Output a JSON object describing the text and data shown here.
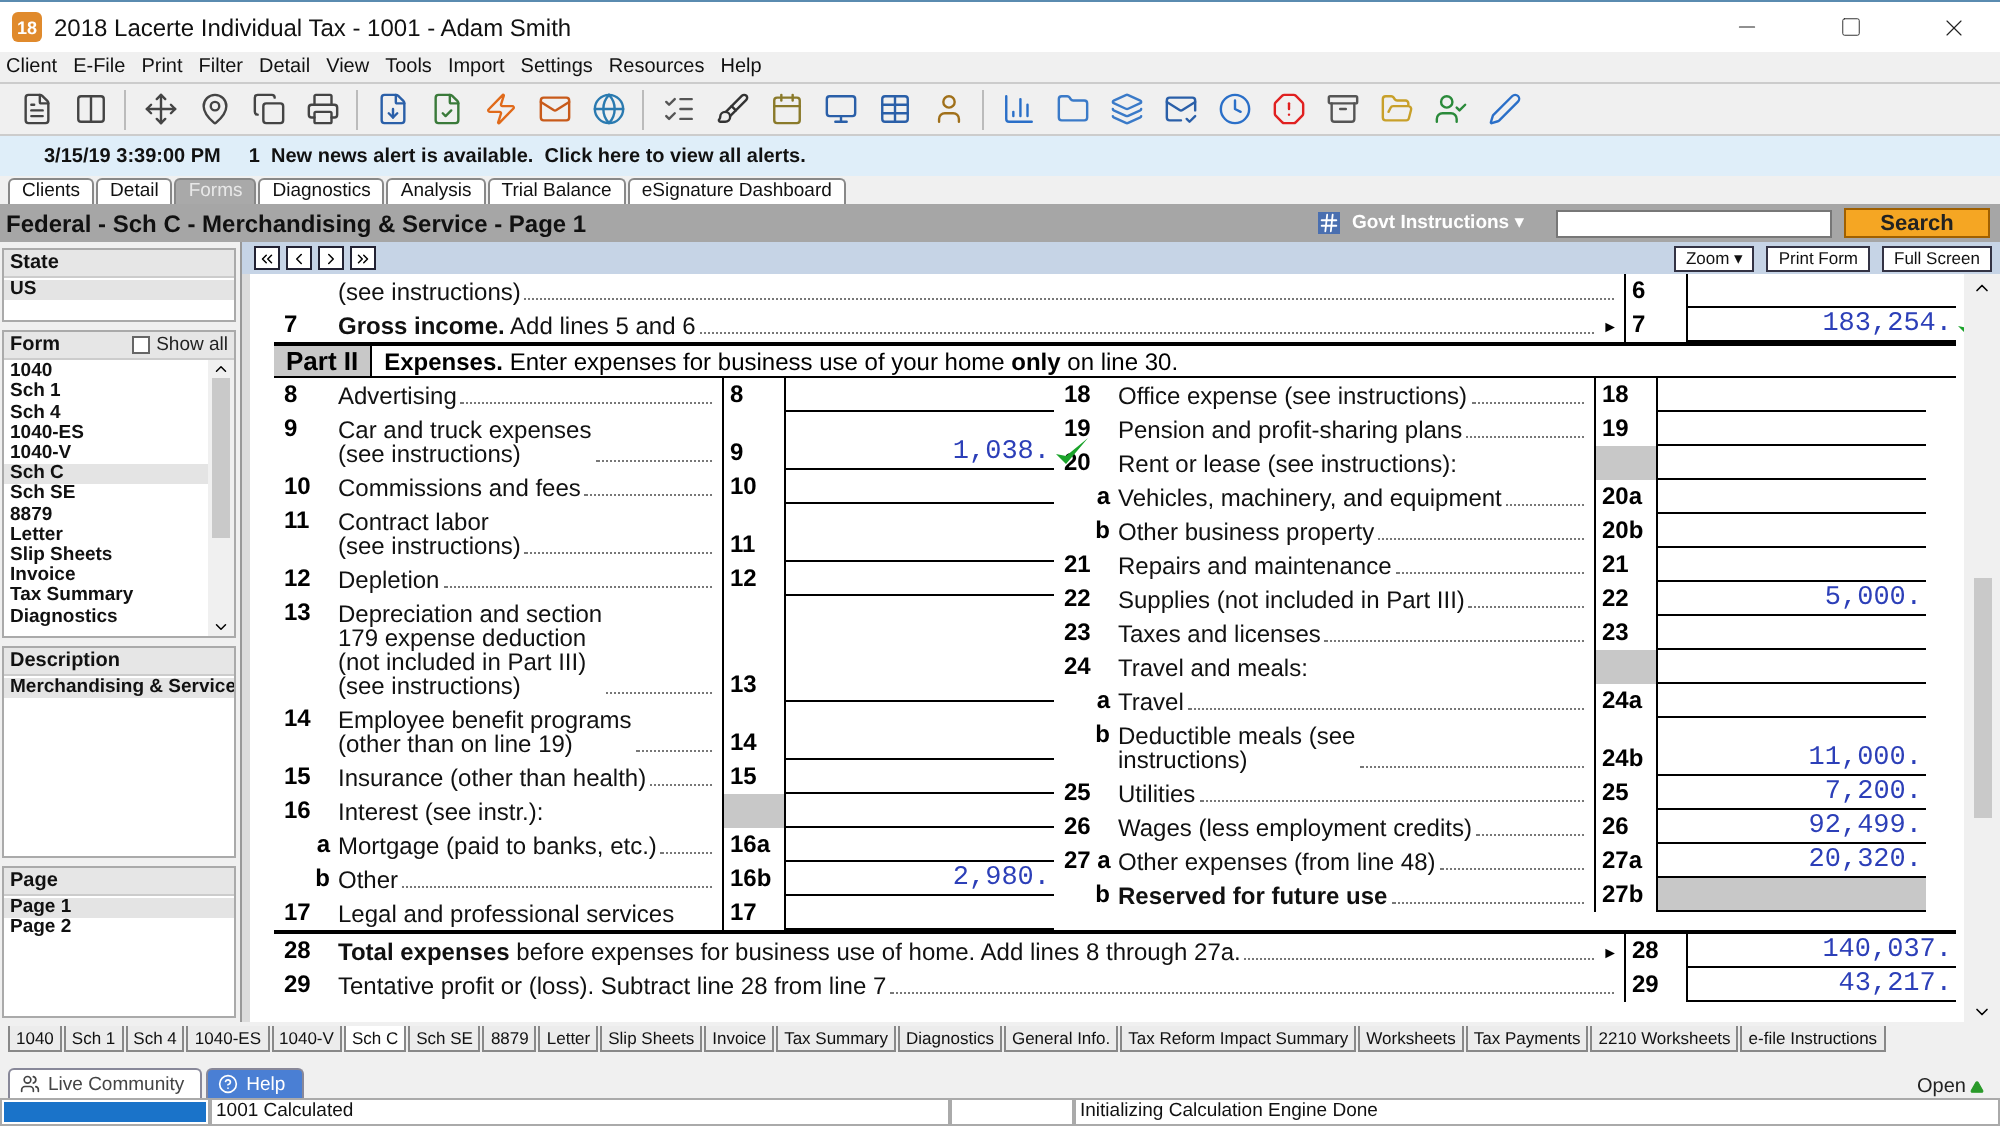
{
  "window": {
    "app_icon_text": "18",
    "title": "2018 Lacerte Individual Tax - 1001 - Adam Smith"
  },
  "menu": [
    "Client",
    "E-File",
    "Print",
    "Filter",
    "Detail",
    "View",
    "Tools",
    "Import",
    "Settings",
    "Resources",
    "Help"
  ],
  "alert": {
    "time": "3/15/19 3:39:00 PM",
    "message": "1  New news alert is available.  Click here to view all alerts."
  },
  "tabs": [
    {
      "label": "Clients",
      "selected": false
    },
    {
      "label": "Detail",
      "selected": false
    },
    {
      "label": "Forms",
      "selected": true
    },
    {
      "label": "Diagnostics",
      "selected": false
    },
    {
      "label": "Analysis",
      "selected": false
    },
    {
      "label": "Trial Balance",
      "selected": false
    },
    {
      "label": "eSignature Dashboard",
      "selected": false
    }
  ],
  "form_header": {
    "title": "Federal - Sch C - Merchandising & Service - Page 1",
    "instructions": "Govt Instructions ▾",
    "search_button": "Search"
  },
  "sidebar": {
    "state": {
      "heading": "State",
      "items": [
        {
          "label": "US",
          "selected": true
        }
      ]
    },
    "form": {
      "heading": "Form",
      "show_all": {
        "label": "Show all",
        "checked": false
      },
      "items": [
        {
          "label": "1040",
          "selected": false
        },
        {
          "label": "Sch 1",
          "selected": false
        },
        {
          "label": "Sch 4",
          "selected": false
        },
        {
          "label": "1040-ES",
          "selected": false
        },
        {
          "label": "1040-V",
          "selected": false
        },
        {
          "label": "Sch C",
          "selected": true
        },
        {
          "label": "Sch SE",
          "selected": false
        },
        {
          "label": "8879",
          "selected": false
        },
        {
          "label": "Letter",
          "selected": false
        },
        {
          "label": "Slip Sheets",
          "selected": false
        },
        {
          "label": "Invoice",
          "selected": false
        },
        {
          "label": "Tax Summary",
          "selected": false
        },
        {
          "label": "Diagnostics",
          "selected": false
        }
      ]
    },
    "description": {
      "heading": "Description",
      "items": [
        {
          "label": "Merchandising & Service",
          "selected": true
        }
      ]
    },
    "page": {
      "heading": "Page",
      "items": [
        {
          "label": "Page 1",
          "selected": true
        },
        {
          "label": "Page 2",
          "selected": false
        }
      ]
    }
  },
  "form_toolbar": {
    "buttons": [
      "Zoom ▾",
      "Print Form",
      "Full Screen"
    ]
  },
  "form": {
    "top_rows": [
      {
        "label": "(see instructions)",
        "leader": true,
        "code": "6",
        "verified": false
      },
      {
        "kind": "main",
        "num": "7",
        "label": "**Gross income.** Add lines 5 and 6",
        "leader": true,
        "arrow": "►",
        "code": "7",
        "value": "183,254.",
        "verified": true
      }
    ],
    "part": {
      "label": "Part II",
      "title": "**Expenses.** Enter expenses for business use of your home **only** on line 30."
    },
    "left_lines": [
      {
        "kind": "main",
        "num": "8",
        "label": "Advertising",
        "leader": true,
        "code": "8",
        "verified": false
      },
      {
        "kind": "main",
        "num": "9",
        "label": "Car and truck expenses\n(see instructions)",
        "leader": true,
        "code": "9",
        "value": "1,038.",
        "verified": true
      },
      {
        "kind": "main",
        "num": "10",
        "label": "Commissions and fees",
        "leader": true,
        "code": "10",
        "verified": false
      },
      {
        "kind": "main",
        "num": "11",
        "label": "Contract labor\n(see instructions)",
        "leader": true,
        "code": "11",
        "verified": false
      },
      {
        "kind": "main",
        "num": "12",
        "label": "Depletion",
        "leader": true,
        "code": "12",
        "verified": false
      },
      {
        "kind": "main",
        "num": "13",
        "label": "Depreciation and section\n179 expense deduction\n(not included in Part III)\n(see instructions)",
        "leader": true,
        "code": "13",
        "verified": false
      },
      {
        "kind": "main",
        "num": "14",
        "label": "Employee benefit programs\n(other than on line 19)",
        "leader": true,
        "code": "14",
        "verified": false
      },
      {
        "kind": "main",
        "num": "15",
        "label": "Insurance (other than health)",
        "leader": true,
        "code": "15",
        "verified": false
      },
      {
        "kind": "main",
        "num": "16",
        "label": "Interest (see instr.):",
        "leader": false,
        "code_shaded": true,
        "verified": false
      },
      {
        "kind": "sub",
        "num": "a",
        "label": "Mortgage (paid to banks, etc.)",
        "leader": true,
        "code": "16a",
        "verified": false
      },
      {
        "kind": "sub",
        "num": "b",
        "label": "Other",
        "leader": true,
        "code": "16b",
        "value": "2,980.",
        "verified": false
      },
      {
        "kind": "main",
        "num": "17",
        "label": "Legal and professional services",
        "leader": false,
        "code": "17",
        "verified": false
      }
    ],
    "right_lines": [
      {
        "kind": "main",
        "num": "18",
        "label": "Office expense (see instructions)",
        "leader": true,
        "code": "18",
        "verified": false
      },
      {
        "kind": "main",
        "num": "19",
        "label": "Pension and profit-sharing plans",
        "leader": true,
        "code": "19",
        "verified": false
      },
      {
        "kind": "main",
        "num": "20",
        "label": "Rent or lease (see instructions):",
        "leader": false,
        "code_shaded": true,
        "verified": false
      },
      {
        "kind": "sub",
        "num": "a",
        "label": "Vehicles, machinery, and equipment",
        "leader": true,
        "code": "20a",
        "verified": false
      },
      {
        "kind": "sub",
        "num": "b",
        "label": "Other business property",
        "leader": true,
        "code": "20b",
        "verified": false
      },
      {
        "kind": "main",
        "num": "21",
        "label": "Repairs and maintenance",
        "leader": true,
        "code": "21",
        "verified": false
      },
      {
        "kind": "main",
        "num": "22",
        "label": "Supplies (not included in Part III)",
        "leader": true,
        "code": "22",
        "value": "5,000.",
        "verified": false
      },
      {
        "kind": "main",
        "num": "23",
        "label": "Taxes and licenses",
        "leader": true,
        "code": "23",
        "verified": false
      },
      {
        "kind": "main",
        "num": "24",
        "label": "Travel and meals:",
        "leader": false,
        "code_shaded": true,
        "verified": false
      },
      {
        "kind": "sub",
        "num": "a",
        "label": "Travel",
        "leader": true,
        "code": "24a",
        "verified": false
      },
      {
        "kind": "sub",
        "num": "b",
        "label": "Deductible meals (see\ninstructions)",
        "leader": true,
        "code": "24b",
        "value": "11,000.",
        "verified": false
      },
      {
        "kind": "main",
        "num": "25",
        "label": "Utilities",
        "leader": true,
        "code": "25",
        "value": "7,200.",
        "verified": false
      },
      {
        "kind": "main",
        "num": "26",
        "label": "Wages (less employment credits)",
        "leader": true,
        "code": "26",
        "value": "92,499.",
        "verified": false
      },
      {
        "kind": "main",
        "num": "27 a",
        "label": "Other expenses (from line 48)",
        "leader": true,
        "code": "27a",
        "value": "20,320.",
        "verified": false
      },
      {
        "kind": "sub",
        "num": "b",
        "label": "Reserved for future use",
        "strong": true,
        "leader": true,
        "code": "27b",
        "value_shaded": true,
        "verified": false
      }
    ],
    "bottom_rows": [
      {
        "kind": "main",
        "num": "28",
        "label": "**Total expenses** before expenses for business use of home. Add lines 8 through 27a.",
        "leader": true,
        "arrow": "►",
        "code": "28",
        "value": "140,037.",
        "verified": false
      },
      {
        "kind": "main",
        "num": "29",
        "label": "Tentative profit or (loss). Subtract line 28 from line 7",
        "leader": true,
        "code": "29",
        "value": "43,217.",
        "verified": false
      }
    ]
  },
  "form_tabs": [
    {
      "label": "1040",
      "selected": false
    },
    {
      "label": "Sch 1",
      "selected": false
    },
    {
      "label": "Sch 4",
      "selected": false
    },
    {
      "label": "1040-ES",
      "selected": false
    },
    {
      "label": "1040-V",
      "selected": false
    },
    {
      "label": "Sch C",
      "selected": true
    },
    {
      "label": "Sch SE",
      "selected": false
    },
    {
      "label": "8879",
      "selected": false
    },
    {
      "label": "Letter",
      "selected": false
    },
    {
      "label": "Slip Sheets",
      "selected": false
    },
    {
      "label": "Invoice",
      "selected": false
    },
    {
      "label": "Tax Summary",
      "selected": false
    },
    {
      "label": "Diagnostics",
      "selected": false
    },
    {
      "label": "General Info.",
      "selected": false
    },
    {
      "label": "Tax Reform Impact Summary",
      "selected": false
    },
    {
      "label": "Worksheets",
      "selected": false
    },
    {
      "label": "Tax Payments",
      "selected": false
    },
    {
      "label": "2210 Worksheets",
      "selected": false
    },
    {
      "label": "e-file Instructions",
      "selected": false
    }
  ],
  "bottom_panel": {
    "tabs": [
      {
        "label": "Live Community",
        "selected": false
      },
      {
        "label": "Help",
        "selected": true
      }
    ],
    "open_label": "Open"
  },
  "status_bar": {
    "progress": {
      "level": 1
    },
    "message": "1001 Calculated",
    "detail": "Initializing Calculation Engine Done"
  }
}
